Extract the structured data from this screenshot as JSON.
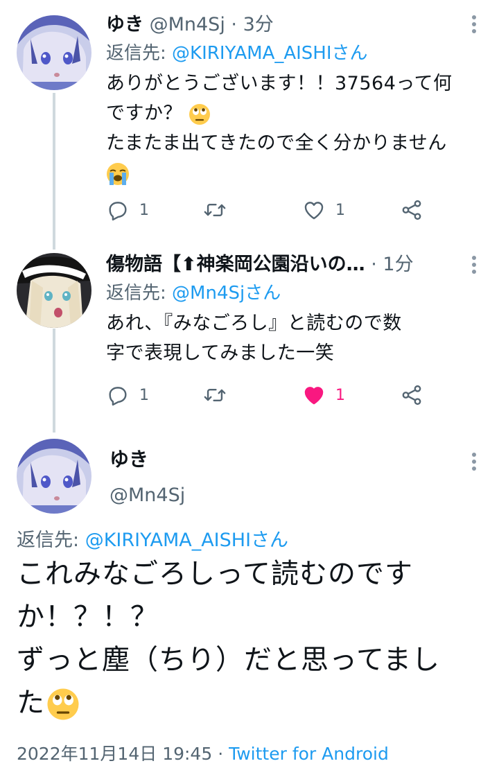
{
  "tweets": [
    {
      "name": "ゆき",
      "handle": "@Mn4Sj",
      "time": "3分",
      "reply_prefix": "返信先: ",
      "reply_handle": "@KIRIYAMA_AISHIさん",
      "lines": [
        "ありがとうございます！！37564って何",
        "ですか？",
        "たまたま出てきたので全く分かりません"
      ],
      "actions": {
        "reply": "1",
        "retweet": "",
        "like": "1"
      },
      "liked": false
    },
    {
      "name": "傷物語【⬆神楽岡公園沿いの…",
      "handle": "",
      "time": "1分",
      "reply_prefix": "返信先: ",
      "reply_handle": "@Mn4Sjさん",
      "lines": [
        "あれ、『みなごろし』と読むので数",
        "字で表現してみました一笑"
      ],
      "actions": {
        "reply": "1",
        "retweet": "",
        "like": "1"
      },
      "liked": true
    }
  ],
  "main": {
    "name": "ゆき",
    "handle": "@Mn4Sj",
    "reply_prefix": "返信先: ",
    "reply_handle": "@KIRIYAMA_AISHIさん",
    "lines": [
      "これみなごろしって読むのです",
      "か！？！？",
      "ずっと塵（ちり）だと思ってまし",
      "た"
    ],
    "timestamp": "2022年11月14日 19:45",
    "separator": " · ",
    "source": "Twitter for Android"
  },
  "colors": {
    "link": "#1d9bf0",
    "muted": "#536471",
    "like_active": "#f91880",
    "thread_line": "#cfd9de"
  },
  "icons": [
    "reply-icon",
    "retweet-icon",
    "like-icon",
    "share-icon",
    "more-icon",
    "rolling-eyes-emoji",
    "crying-face-emoji"
  ]
}
